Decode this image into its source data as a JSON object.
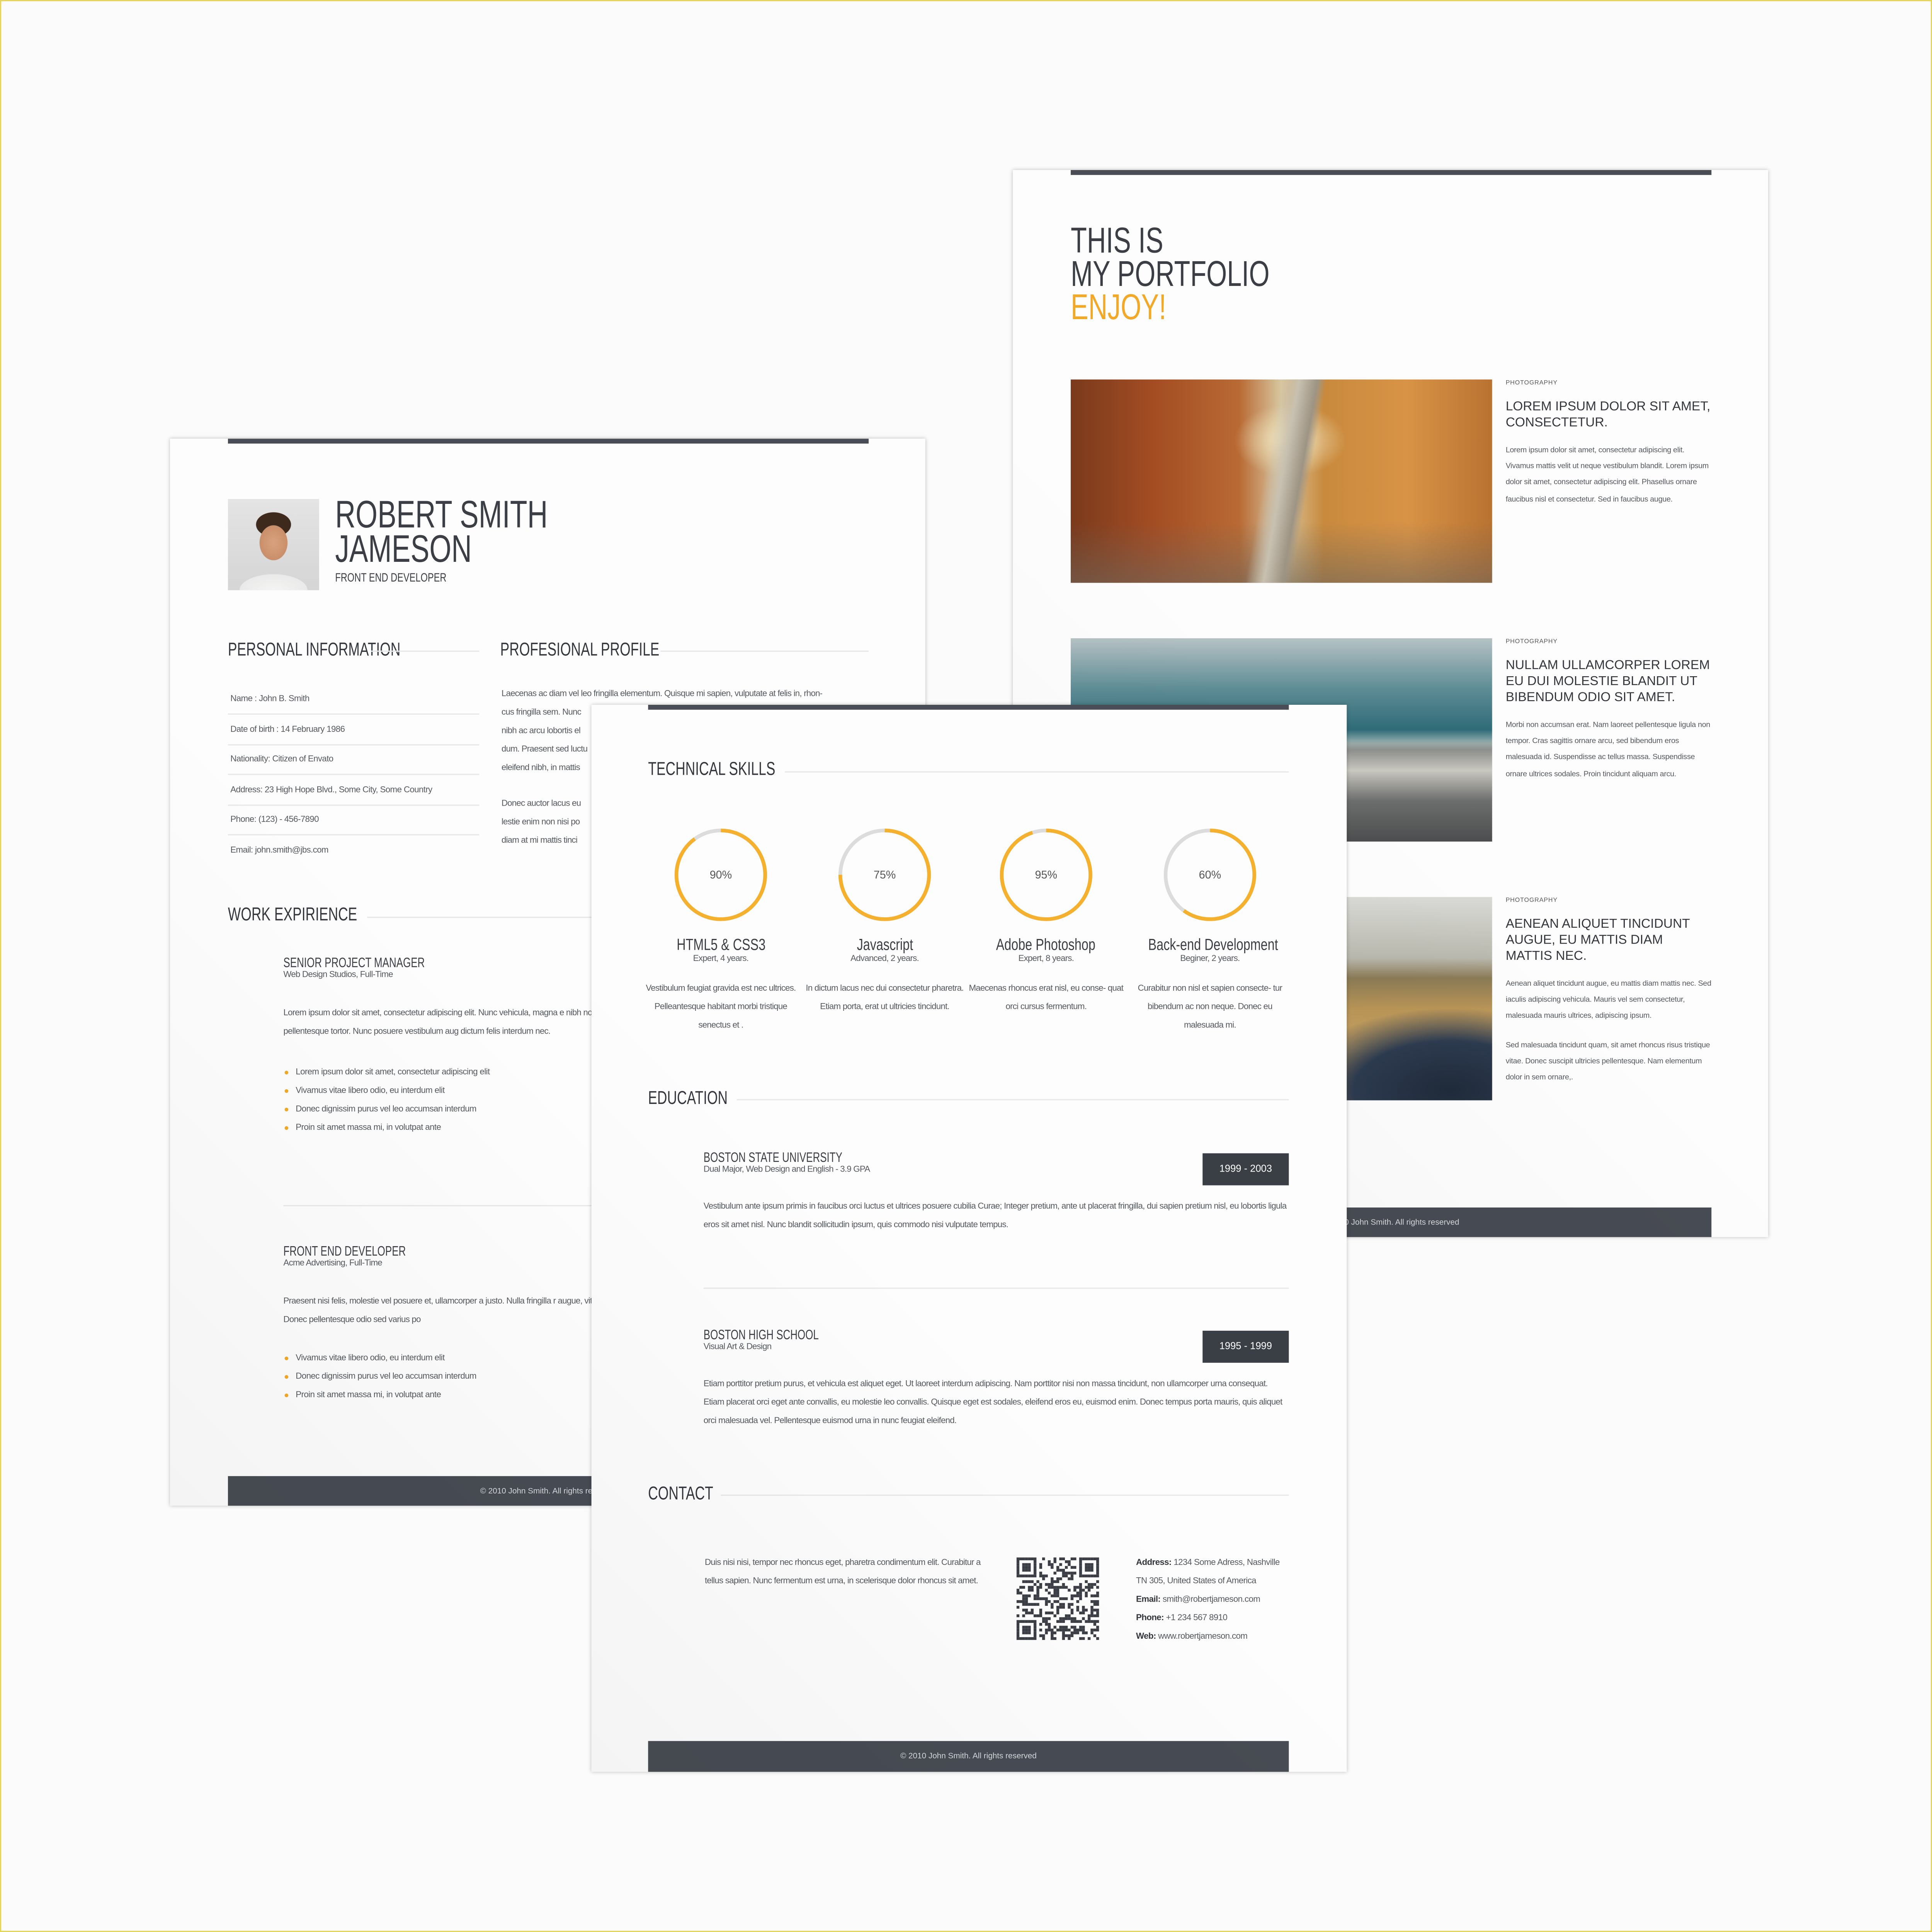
{
  "colors": {
    "accent": "#f2a928",
    "dark": "#474b53",
    "text": "#3b3e45"
  },
  "resume": {
    "name_line1": "ROBERT SMITH",
    "name_line2": "JAMESON",
    "role": "FRONT END DEVELOPER",
    "personal_heading": "PERSONAL INFORMATION",
    "profile_heading": "PROFESIONAL PROFILE",
    "personal": [
      "Name : John B. Smith",
      "Date of birth : 14 February 1986",
      "Nationality: Citizen of Envato",
      "Address: 23  High Hope Blvd., Some City, Some Country",
      "Phone: (123) - 456-7890",
      "Email: john.smith@jbs.com"
    ],
    "profile_lines": [
      "Laecenas ac diam vel leo fringilla elementum. Quisque mi sapien, vulputate at felis in, rhon-",
      "cus fringilla sem. Nunc",
      "nibh ac arcu lobortis el",
      "dum. Praesent sed luctu",
      "eleifend nibh, in mattis",
      "Donec auctor lacus eu",
      "lestie enim non nisi po",
      "diam at mi mattis tinci"
    ],
    "work_heading": "WORK EXPIRIENCE",
    "jobs": [
      {
        "title": "SENIOR PROJECT MANAGER",
        "company": "Web Design Studios, Full-Time",
        "text": "Lorem ipsum dolor sit amet, consectetur adipiscing elit. Nunc vehicula, magna e nibh non lectus. Curabitur in pellentesque tortor. Nunc posuere vestibulum aug dictum felis interdum nec.",
        "bullets": [
          "Lorem ipsum dolor sit amet, consectetur adipiscing elit",
          "Vivamus vitae libero odio, eu interdum elit",
          "Donec dignissim purus vel leo accumsan interdum",
          "Proin sit amet massa mi, in volutpat ante"
        ]
      },
      {
        "title": "FRONT END DEVELOPER",
        "company": "Acme Advertising, Full-Time",
        "text": "Praesent nisi felis, molestie vel posuere et, ullamcorper a justo. Nulla fringilla r augue, vitae tristique augue lobortis eu. Donec pellentesque odio sed varius po",
        "bullets": [
          "Vivamus vitae libero odio, eu interdum elit",
          "Donec dignissim purus vel leo accumsan interdum",
          "Proin sit amet massa mi, in volutpat ante"
        ]
      }
    ],
    "footer": "© 2010 John Smith. All rights reserved"
  },
  "portfolio": {
    "title_line1": "THIS IS",
    "title_line2": "MY PORTFOLIO",
    "title_line3": "ENJOY!",
    "items": [
      {
        "category": "PHOTOGRAPHY",
        "title": "LOREM IPSUM DOLOR SIT AMET, CONSECTETUR.",
        "body": "Lorem ipsum dolor sit amet, consectetur adipiscing elit. Vivamus mattis velit ut neque vestibulum blandit. Lorem ipsum dolor sit amet, consectetur adipiscing elit. Phasellus ornare faucibus nisl et consectetur. Sed in faucibus augue.",
        "body2": "",
        "image": "narrow-alley-photo"
      },
      {
        "category": "PHOTOGRAPHY",
        "title": "NULLAM ULLAMCORPER LOREM EU DUI MOLESTIE BLANDIT UT BIBENDUM ODIO SIT AMET.",
        "body": "Morbi non accumsan erat. Nam laoreet pellentesque ligula non tempor. Cras sagittis ornare arcu, sed bibendum eros malesuada id. Suspendisse ac tellus massa. Suspendisse ornare ultrices sodales. Proin tincidunt aliquam arcu.",
        "body2": "",
        "image": "city-skyline-photo"
      },
      {
        "category": "PHOTOGRAPHY",
        "title": "AENEAN ALIQUET TINCIDUNT AUGUE, EU MATTIS DIAM MATTIS NEC.",
        "body": "Aenean aliquet tincidunt augue, eu mattis diam mattis nec. Sed iaculis adipiscing vehicula. Mauris vel sem consectetur, malesuada mauris ultrices, adipiscing ipsum.",
        "body2": "Sed malesuada tincidunt quam, sit amet rhoncus risus tristique vitae. Donec suscipit ultricies pellentesque. Nam elementum dolor in sem ornare,.",
        "image": "field-sneakers-photo"
      }
    ],
    "footer": "© 2010 John Smith. All rights reserved"
  },
  "skills_page": {
    "skills_heading": "TECHNICAL SKILLS",
    "skills": [
      {
        "name": "HTML5 & CSS3",
        "percent": 90,
        "label": "90%",
        "level": "Expert, 4 years.",
        "desc": "Vestibulum feugiat gravida est nec ultrices. Pelleantesque habitant morbi tristique senectus et ."
      },
      {
        "name": "Javascript",
        "percent": 75,
        "label": "75%",
        "level": "Advanced, 2 years.",
        "desc": "In dictum lacus nec dui consectetur pharetra. Etiam porta, erat ut ultricies tincidunt."
      },
      {
        "name": "Adobe Photoshop",
        "percent": 95,
        "label": "95%",
        "level": "Expert, 8 years.",
        "desc": "Maecenas rhoncus erat nisl, eu conse- quat orci cursus fermentum."
      },
      {
        "name": "Back-end Development",
        "percent": 60,
        "label": "60%",
        "level": "Beginer, 2 years.",
        "desc": "Curabitur non nisl et sapien consecte- tur bibendum ac non neque. Donec eu malesuada mi."
      }
    ],
    "education_heading": "EDUCATION",
    "education": [
      {
        "school": "BOSTON STATE UNIVERSITY",
        "detail": "Dual Major, Web Design and English - 3.9 GPA",
        "years": "1999 - 2003",
        "text": "Vestibulum ante ipsum primis in faucibus orci luctus et ultrices posuere cubilia Curae; Integer pretium, ante ut placerat fringilla, dui sapien pretium nisl, eu lobortis ligula eros sit amet nisl. Nunc blandit sollicitudin ipsum, quis commodo nisi vulputate tempus."
      },
      {
        "school": "BOSTON HIGH SCHOOL",
        "detail": "Visual Art & Design",
        "years": "1995 - 1999",
        "text": "Etiam porttitor pretium purus, et vehicula est aliquet eget. Ut laoreet interdum adipiscing. Nam porttitor nisi non massa tincidunt, non ullamcorper urna consequat. Etiam placerat orci eget ante convallis, eu molestie leo convallis. Quisque eget est sodales, eleifend eros eu, euismod enim. Donec tempus porta mauris, quis aliquet orci malesuada vel. Pellentesque euismod urna in nunc feugiat eleifend."
      }
    ],
    "contact_heading": "CONTACT",
    "contact_text": "Duis nisi nisi, tempor nec rhoncus eget, pharetra condimentum elit. Curabitur a tellus sapien. Nunc fermentum est urna, in scelerisque dolor rhoncus sit amet.",
    "contact": {
      "address_label": "Address:",
      "address_line1": "1234 Some Adress, Nashville",
      "address_line2": "TN 305, United States of America",
      "email_label": "Email:",
      "email": "smith@robertjameson.com",
      "phone_label": "Phone:",
      "phone": "+1 234 567 8910",
      "web_label": "Web:",
      "web": "www.robertjameson.com"
    },
    "footer": "© 2010 John Smith. All rights reserved"
  }
}
